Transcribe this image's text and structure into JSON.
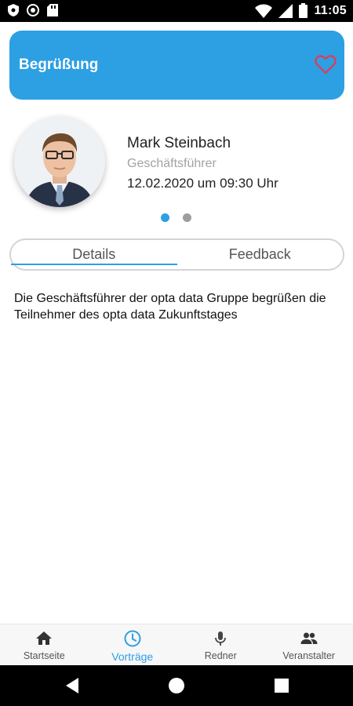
{
  "statusbar": {
    "time": "11:05",
    "icons_left": [
      "shield-icon",
      "circle-icon",
      "sd-card-icon"
    ],
    "icons_right": [
      "wifi-icon",
      "signal-icon",
      "battery-icon"
    ]
  },
  "header": {
    "title": "Begrüßung",
    "color": "#2d9fe3",
    "favorite_icon": "heart-outline-icon",
    "favorite_color": "#e53950"
  },
  "speaker": {
    "name": "Mark Steinbach",
    "role": "Geschäftsführer",
    "datetime": "12.02.2020 um 09:30 Uhr"
  },
  "pager": {
    "count": 2,
    "active_index": 0
  },
  "tabs": [
    {
      "label": "Details",
      "active": true
    },
    {
      "label": "Feedback",
      "active": false
    }
  ],
  "description": "Die Geschäftsführer der opta data Gruppe begrüßen die Teilnehmer des opta data Zukunftstages",
  "bottom_nav": [
    {
      "label": "Startseite",
      "icon": "home-icon",
      "active": false
    },
    {
      "label": "Vorträge",
      "icon": "clock-icon",
      "active": true
    },
    {
      "label": "Redner",
      "icon": "microphone-icon",
      "active": false
    },
    {
      "label": "Veranstalter",
      "icon": "people-icon",
      "active": false
    }
  ],
  "system_nav": [
    "back-icon",
    "home-circle-icon",
    "recents-icon"
  ]
}
